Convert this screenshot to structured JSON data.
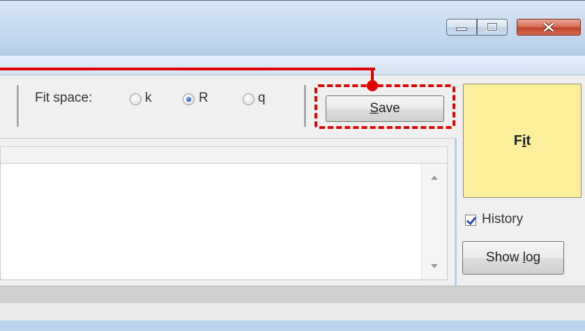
{
  "window": {
    "controls": {
      "minimize_icon": "minimize-icon",
      "maximize_icon": "maximize-icon",
      "close_icon": "close-icon"
    }
  },
  "toolbar": {
    "fit_space": {
      "label": "Fit space:",
      "options": [
        {
          "label": "k",
          "checked": false
        },
        {
          "label": "R",
          "checked": true
        },
        {
          "label": "q",
          "checked": false
        }
      ]
    },
    "save_button": {
      "prefix_underlined": "S",
      "rest": "ave"
    }
  },
  "side": {
    "fit_button": {
      "before": "F",
      "underlined": "i",
      "after": "t",
      "color": "#fbef9c"
    },
    "history": {
      "label": "History",
      "checked": true
    },
    "show_log_button": {
      "before": "Show ",
      "underlined": "l",
      "after": "og"
    }
  },
  "annotation": {
    "color": "#e10000"
  }
}
